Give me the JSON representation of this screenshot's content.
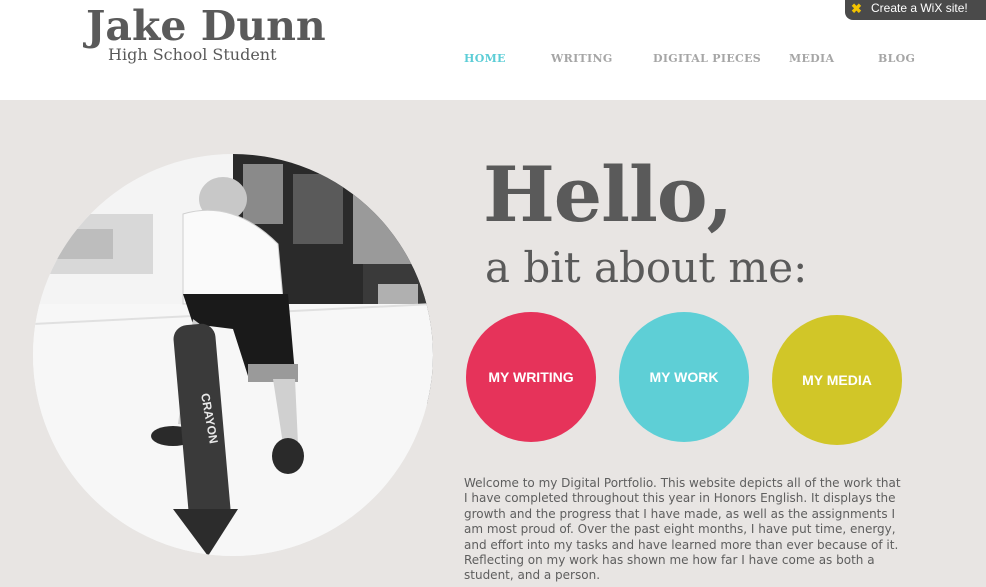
{
  "site": {
    "title": "Jake Dunn",
    "subtitle": "High School Student"
  },
  "nav": {
    "items": [
      {
        "label": "HOME",
        "active": true
      },
      {
        "label": "WRITING",
        "active": false
      },
      {
        "label": "DIGITAL PIECES",
        "active": false
      },
      {
        "label": "MEDIA",
        "active": false
      },
      {
        "label": "BLOG",
        "active": false
      }
    ]
  },
  "wix_badge": {
    "label": "Create a WiX site!",
    "icon": "wix-star-icon"
  },
  "hero": {
    "heading": "Hello,",
    "subheading": "a bit about me:",
    "photo_text": "CRAYON"
  },
  "buttons": {
    "writing": "MY WRITING",
    "work": "MY WORK",
    "media": "MY MEDIA"
  },
  "intro": {
    "text": "Welcome to my Digital Portfolio. This website depicts all of the work that I have completed throughout this year in Honors English. It displays the growth and the progress that I have made, as well as the assignments I am most proud of. Over the past eight months, I have put time, energy, and effort into my tasks and have learned more than ever because of it. Reflecting on my work has shown me how far I have come as both a student, and a person."
  },
  "colors": {
    "accent_active": "#5ccdd6",
    "writing": "#e6335a",
    "work": "#5ecfd6",
    "media": "#d1c628",
    "text": "#5a5a5a",
    "background": "#e8e5e3"
  }
}
